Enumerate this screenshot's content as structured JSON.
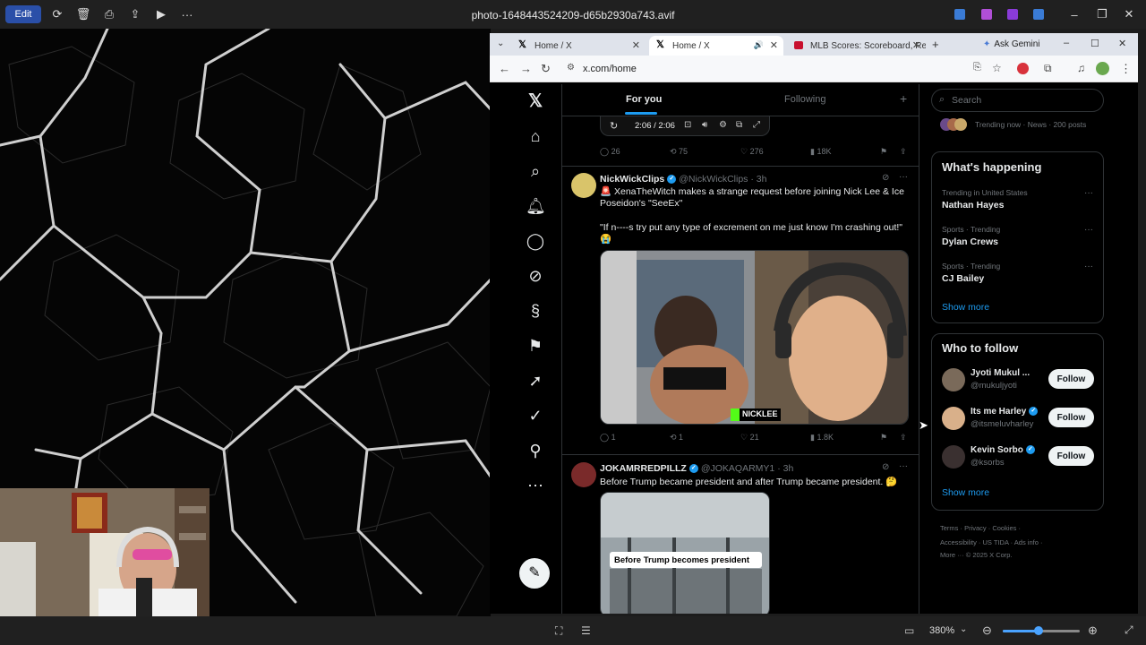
{
  "viewer": {
    "edit_label": "Edit",
    "title": "photo-1648443524209-d65b2930a743.avif",
    "zoom": "380%"
  },
  "browser": {
    "tabs": [
      {
        "label": "Home / X"
      },
      {
        "label": "Home / X"
      },
      {
        "label": "MLB Scores: Scoreboard, Resu"
      }
    ],
    "ask_gemini": "Ask Gemini",
    "url": "x.com/home"
  },
  "x": {
    "tabs": {
      "for_you": "For you",
      "following": "Following"
    },
    "video_time": "2:06 / 2:06",
    "tweet0": {
      "replies": "26",
      "retweets": "75",
      "likes": "276",
      "views": "18K"
    },
    "tweet1": {
      "name": "NickWickClips",
      "handle": "@NickWickClips",
      "time": "· 3h",
      "line1": "🚨 XenaTheWitch makes a strange request before joining Nick Lee & Ice Poseidon's \"SeeEx\"",
      "line2": "\"If n----s try put any type of excrement on me just know I'm crashing out!\"",
      "emoji": "😭",
      "watermark": "NICKLEE",
      "replies": "1",
      "retweets": "1",
      "likes": "21",
      "views": "1.8K"
    },
    "tweet2": {
      "name": "JOKAMRREDPILLZ",
      "handle": "@JOKAQARMY1",
      "time": "· 3h",
      "text": "Before Trump became president and after Trump became president. 🤔",
      "caption": "Before Trump becomes president"
    },
    "search_placeholder": "Search",
    "trending_now": "Trending now · News · 200 posts",
    "whats_happening": {
      "title": "What's happening",
      "items": [
        {
          "category": "Trending in United States",
          "name": "Nathan Hayes"
        },
        {
          "category": "Sports · Trending",
          "name": "Dylan Crews"
        },
        {
          "category": "Sports · Trending",
          "name": "CJ Bailey"
        }
      ],
      "show_more": "Show more"
    },
    "who_to_follow": {
      "title": "Who to follow",
      "users": [
        {
          "name": "Jyoti Mukul ...",
          "handle": "@mukuljyoti",
          "button": "Follow"
        },
        {
          "name": "Its me Harley",
          "handle": "@itsmeluvharley",
          "button": "Follow"
        },
        {
          "name": "Kevin Sorbo",
          "handle": "@ksorbs",
          "button": "Follow"
        }
      ],
      "show_more": "Show more"
    },
    "footer": {
      "line1": "Terms  ·  Privacy  ·  Cookies  ·",
      "line2": "Accessibility  ·  US TIDA  ·  Ads info  ·",
      "line3": "More ···  © 2025 X Corp."
    }
  }
}
